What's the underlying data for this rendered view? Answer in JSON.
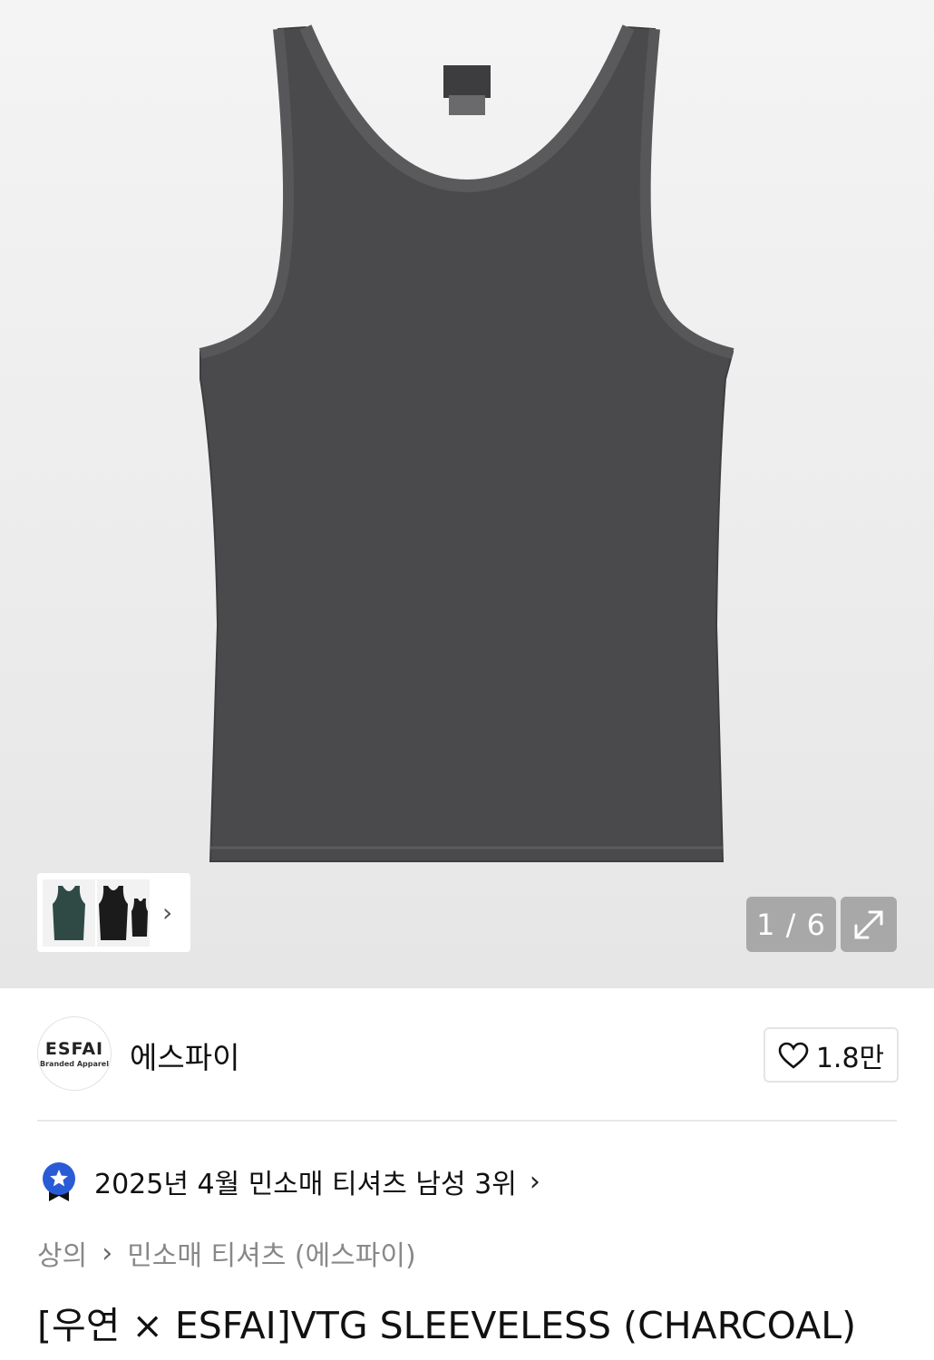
{
  "gallery": {
    "counter": "1 / 6",
    "thumbnails": [
      {
        "color": "#2f4a45",
        "label": "green-tank-thumb"
      },
      {
        "color": "#1b1b1b",
        "label": "black-tank-thumb"
      }
    ],
    "shirt_color": "#4a4a4c"
  },
  "brand": {
    "logo_line1": "ESFAI",
    "logo_line2": "Branded Apparel",
    "name": "에스파이"
  },
  "like": {
    "count": "1.8만"
  },
  "ranking": {
    "text": "2025년 4월 민소매 티셔츠 남성 3위"
  },
  "breadcrumb": {
    "items": [
      "상의",
      "민소매 티셔츠 (에스파이)"
    ]
  },
  "product": {
    "title": "[우연 × ESFAI]VTG SLEEVELESS (CHARCOAL)"
  }
}
